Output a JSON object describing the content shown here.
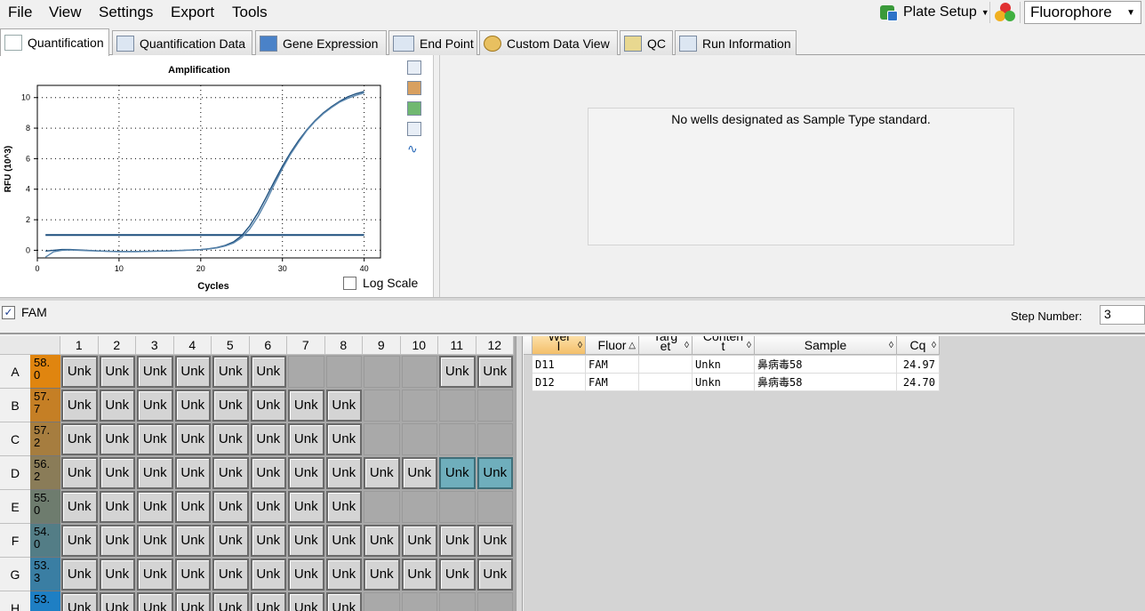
{
  "menu": [
    "File",
    "View",
    "Settings",
    "Export",
    "Tools"
  ],
  "toolbar": {
    "plate_setup": "Plate Setup",
    "fluorophore": "Fluorophore"
  },
  "tabs": [
    {
      "label": "Quantification",
      "active": true,
      "icon": "amplification-curve-icon"
    },
    {
      "label": "Quantification Data",
      "icon": "data-table-icon"
    },
    {
      "label": "Gene Expression",
      "icon": "bar-chart-icon"
    },
    {
      "label": "End Point",
      "icon": "end-point-icon"
    },
    {
      "label": "Custom Data View",
      "icon": "gears-icon"
    },
    {
      "label": "QC",
      "icon": "qc-checklist-icon"
    },
    {
      "label": "Run Information",
      "icon": "run-info-icon"
    }
  ],
  "chart_data": {
    "type": "line",
    "title": "Amplification",
    "xlabel": "Cycles",
    "ylabel": "RFU (10^3)",
    "xlim": [
      0,
      42
    ],
    "ylim": [
      -0.5,
      10.8
    ],
    "x_ticks": [
      0,
      10,
      20,
      30,
      40
    ],
    "y_ticks": [
      0,
      2,
      4,
      6,
      8,
      10
    ],
    "grid": true,
    "threshold": 1.0,
    "series": [
      {
        "well": "D11",
        "color": "#1d4f7e",
        "x": [
          1,
          2,
          3,
          4,
          6,
          8,
          10,
          12,
          14,
          16,
          18,
          20,
          21,
          22,
          23,
          24,
          25,
          26,
          27,
          28,
          29,
          30,
          31,
          32,
          33,
          34,
          35,
          36,
          37,
          38,
          39,
          40
        ],
        "y": [
          -0.05,
          0.0,
          0.05,
          0.05,
          0.0,
          -0.05,
          -0.08,
          -0.08,
          -0.06,
          -0.04,
          0.0,
          0.05,
          0.1,
          0.18,
          0.32,
          0.55,
          0.95,
          1.6,
          2.45,
          3.45,
          4.5,
          5.5,
          6.4,
          7.2,
          7.9,
          8.5,
          9.0,
          9.4,
          9.75,
          10.05,
          10.25,
          10.4
        ]
      },
      {
        "well": "D12",
        "color": "#5a86ad",
        "x": [
          1,
          2,
          3,
          4,
          6,
          8,
          10,
          12,
          14,
          16,
          18,
          20,
          21,
          22,
          23,
          24,
          25,
          26,
          27,
          28,
          29,
          30,
          31,
          32,
          33,
          34,
          35,
          36,
          37,
          38,
          39,
          40
        ],
        "y": [
          -0.45,
          -0.1,
          0.0,
          0.02,
          -0.02,
          -0.06,
          -0.09,
          -0.09,
          -0.07,
          -0.05,
          -0.01,
          0.04,
          0.09,
          0.16,
          0.28,
          0.48,
          0.82,
          1.4,
          2.2,
          3.2,
          4.3,
          5.35,
          6.3,
          7.1,
          7.85,
          8.45,
          8.95,
          9.35,
          9.7,
          9.95,
          10.15,
          10.3
        ]
      }
    ]
  },
  "chart_panel": {
    "tool_icons": [
      "copy-icon",
      "properties-icon",
      "export-icon",
      "zoom-icon",
      "line-style-icon"
    ],
    "log_scale_label": "Log Scale",
    "log_scale_checked": false
  },
  "std_curve_panel": {
    "message": "No wells designated as Sample Type standard."
  },
  "fluor_filter": {
    "label": "FAM",
    "checked": true
  },
  "step": {
    "label": "Step Number:",
    "value": "3"
  },
  "plate": {
    "columns": [
      "1",
      "2",
      "3",
      "4",
      "5",
      "6",
      "7",
      "8",
      "9",
      "10",
      "11",
      "12"
    ],
    "rows": [
      {
        "label": "A",
        "temp": "58.\n0",
        "temp_color": "#e0850f",
        "wells": [
          "Unk",
          "Unk",
          "Unk",
          "Unk",
          "Unk",
          "Unk",
          "",
          "",
          "",
          "",
          "Unk",
          "Unk"
        ],
        "selected": []
      },
      {
        "label": "B",
        "temp": "57.\n7",
        "temp_color": "#c57f25",
        "wells": [
          "Unk",
          "Unk",
          "Unk",
          "Unk",
          "Unk",
          "Unk",
          "Unk",
          "Unk",
          "",
          "",
          "",
          ""
        ],
        "selected": []
      },
      {
        "label": "C",
        "temp": "57.\n2",
        "temp_color": "#a67d3f",
        "wells": [
          "Unk",
          "Unk",
          "Unk",
          "Unk",
          "Unk",
          "Unk",
          "Unk",
          "Unk",
          "",
          "",
          "",
          ""
        ],
        "selected": []
      },
      {
        "label": "D",
        "temp": "56.\n2",
        "temp_color": "#8a7c58",
        "wells": [
          "Unk",
          "Unk",
          "Unk",
          "Unk",
          "Unk",
          "Unk",
          "Unk",
          "Unk",
          "Unk",
          "Unk",
          "Unk",
          "Unk"
        ],
        "selected": [
          10,
          11
        ]
      },
      {
        "label": "E",
        "temp": "55.\n0",
        "temp_color": "#6e7c6e",
        "wells": [
          "Unk",
          "Unk",
          "Unk",
          "Unk",
          "Unk",
          "Unk",
          "Unk",
          "Unk",
          "",
          "",
          "",
          ""
        ],
        "selected": []
      },
      {
        "label": "F",
        "temp": "54.\n0",
        "temp_color": "#537d86",
        "wells": [
          "Unk",
          "Unk",
          "Unk",
          "Unk",
          "Unk",
          "Unk",
          "Unk",
          "Unk",
          "Unk",
          "Unk",
          "Unk",
          "Unk"
        ],
        "selected": []
      },
      {
        "label": "G",
        "temp": "53.\n3",
        "temp_color": "#3a7ea3",
        "wells": [
          "Unk",
          "Unk",
          "Unk",
          "Unk",
          "Unk",
          "Unk",
          "Unk",
          "Unk",
          "Unk",
          "Unk",
          "Unk",
          "Unk"
        ],
        "selected": []
      },
      {
        "label": "H",
        "temp": "53.",
        "temp_color": "#1e7fc4",
        "wells": [
          "Unk",
          "Unk",
          "Unk",
          "Unk",
          "Unk",
          "Unk",
          "Unk",
          "Unk",
          "",
          "",
          "",
          ""
        ],
        "selected": []
      }
    ]
  },
  "results_table": {
    "headers": [
      "Wel\nl",
      "Fluor",
      "Targ\net",
      "Conten\nt",
      "Sample",
      "Cq"
    ],
    "rows": [
      [
        "D11",
        "FAM",
        "",
        "Unkn",
        "鼻病毒58",
        "24.97"
      ],
      [
        "D12",
        "FAM",
        "",
        "Unkn",
        "鼻病毒58",
        "24.70"
      ]
    ]
  }
}
